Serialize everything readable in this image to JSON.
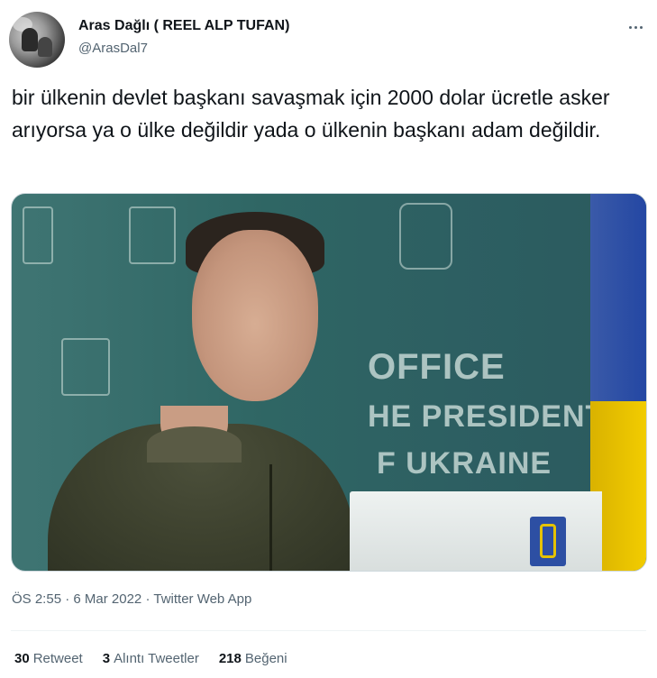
{
  "author": {
    "name": "Aras Dağlı ( REEL ALP TUFAN)",
    "handle": "@ArasDal7"
  },
  "tweet": {
    "text": "bir ülkenin devlet başkanı savaşmak için 2000 dolar ücretle asker arıyorsa ya o ülke değildir yada o ülkenin başkanı adam değildir."
  },
  "media": {
    "bg_text_line1": "OFFICE",
    "bg_text_line2": "HE PRESIDENT",
    "bg_text_line3": "F UKRAINE"
  },
  "meta": {
    "time": "ÖS 2:55",
    "date": "6 Mar 2022",
    "source": "Twitter Web App",
    "separator": "·"
  },
  "stats": {
    "retweets_count": "30",
    "retweets_label": "Retweet",
    "quotes_count": "3",
    "quotes_label": "Alıntı Tweetler",
    "likes_count": "218",
    "likes_label": "Beğeni"
  },
  "colors": {
    "text_primary": "#0f1419",
    "text_secondary": "#536471",
    "border": "#cfd9de"
  }
}
